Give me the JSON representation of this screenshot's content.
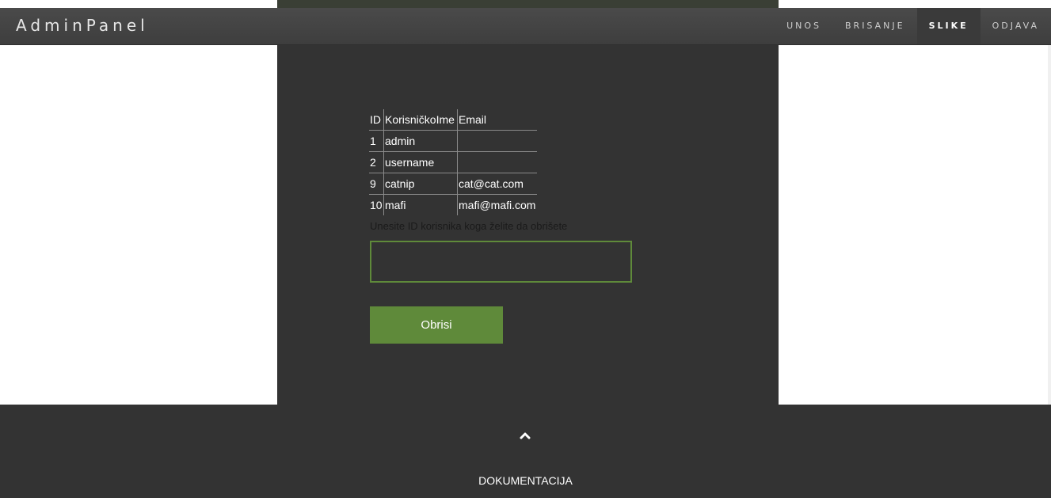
{
  "brand": "AdminPanel",
  "nav": {
    "items": [
      "UNOS",
      "BRISANJE",
      "SLIKE",
      "ODJAVA"
    ],
    "active": "SLIKE"
  },
  "table": {
    "headers": [
      "ID",
      "KorisničkoIme",
      "Email"
    ],
    "rows": [
      [
        "1",
        "admin",
        ""
      ],
      [
        "2",
        "username",
        ""
      ],
      [
        "9",
        "catnip",
        "cat@cat.com"
      ],
      [
        "10",
        "mafi",
        "mafi@mafi.com"
      ]
    ]
  },
  "form": {
    "prompt": "Unesite ID korisnika koga želite da obrišete",
    "input_value": "",
    "button_label": "Obrisi"
  },
  "footer": {
    "up_icon": "chevron-up-icon",
    "link": "DOKUMENTACIJA"
  },
  "colors": {
    "accent": "#5f8a3a",
    "panel": "#333333",
    "navbar": "#444444"
  }
}
